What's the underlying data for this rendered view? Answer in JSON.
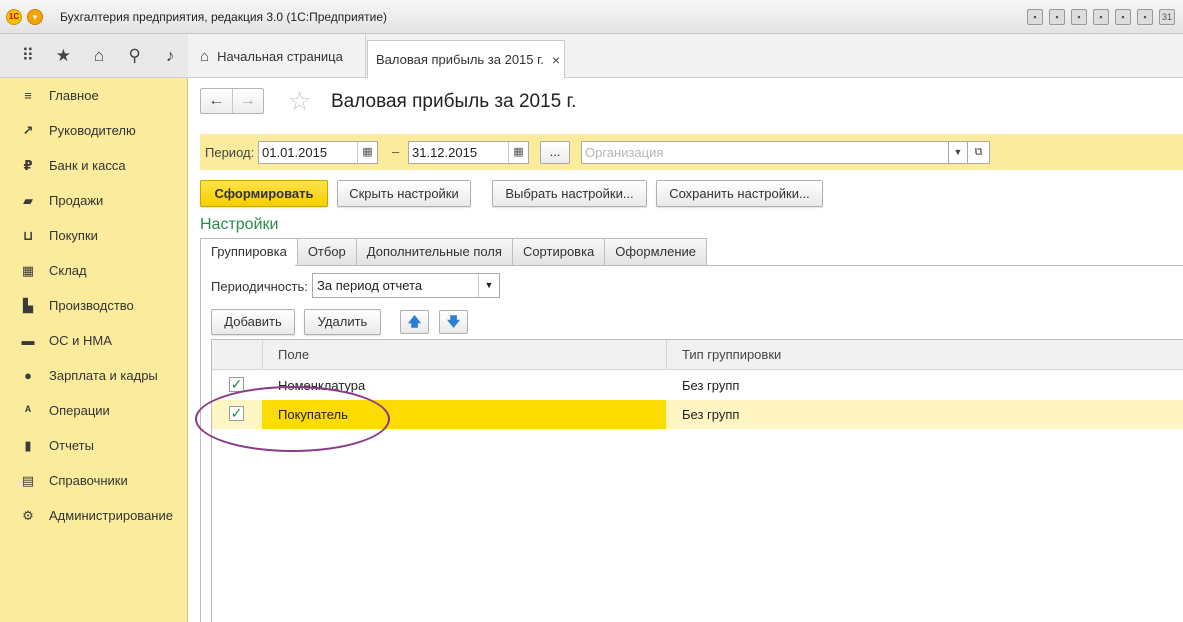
{
  "window": {
    "title": "Бухгалтерия предприятия, редакция 3.0  (1С:Предприятие)",
    "logo_text": "1С"
  },
  "toolbar_icons": [
    "apps-grid-icon",
    "star-icon",
    "history-icon",
    "search-icon",
    "bell-icon"
  ],
  "tabs": {
    "home_label": "Начальная страница",
    "active_label": "Валовая прибыль за 2015 г.",
    "close_glyph": "×"
  },
  "sidebar": {
    "items": [
      {
        "label": "Главное",
        "icon": "≡",
        "icon_name": "menu-icon"
      },
      {
        "label": "Руководителю",
        "icon": "↗",
        "icon_name": "trend-icon"
      },
      {
        "label": "Банк и касса",
        "icon": "₽",
        "icon_name": "ruble-icon"
      },
      {
        "label": "Продажи",
        "icon": "▰",
        "icon_name": "bag-icon"
      },
      {
        "label": "Покупки",
        "icon": "⊔",
        "icon_name": "cart-icon"
      },
      {
        "label": "Склад",
        "icon": "▦",
        "icon_name": "warehouse-icon"
      },
      {
        "label": "Производство",
        "icon": "▙",
        "icon_name": "factory-icon"
      },
      {
        "label": "ОС и НМА",
        "icon": "▬",
        "icon_name": "truck-icon"
      },
      {
        "label": "Зарплата и кадры",
        "icon": "●",
        "icon_name": "person-icon"
      },
      {
        "label": "Операции",
        "icon": "ᴬ",
        "icon_name": "operations-icon"
      },
      {
        "label": "Отчеты",
        "icon": "▮",
        "icon_name": "chart-icon"
      },
      {
        "label": "Справочники",
        "icon": "▤",
        "icon_name": "book-icon"
      },
      {
        "label": "Администрирование",
        "icon": "⚙",
        "icon_name": "gear-icon"
      }
    ]
  },
  "document": {
    "title": "Валовая прибыль за 2015 г."
  },
  "period": {
    "label": "Период:",
    "from": "01.01.2015",
    "to": "31.12.2015",
    "dash": "–",
    "dots": "...",
    "org_placeholder": "Организация"
  },
  "actions": {
    "generate": "Сформировать",
    "hide_settings": "Скрыть настройки",
    "choose_settings": "Выбрать настройки...",
    "save_settings": "Сохранить настройки..."
  },
  "settings": {
    "heading": "Настройки",
    "tabs": [
      "Группировка",
      "Отбор",
      "Дополнительные поля",
      "Сортировка",
      "Оформление"
    ],
    "periodicity_label": "Периодичность:",
    "periodicity_value": "За период отчета",
    "add_label": "Добавить",
    "delete_label": "Удалить",
    "table": {
      "columns": [
        "Поле",
        "Тип группировки"
      ],
      "rows": [
        {
          "checked": true,
          "field": "Номенклатура",
          "type": "Без групп"
        },
        {
          "checked": true,
          "field": "Покупатель",
          "type": "Без групп"
        }
      ]
    }
  },
  "colors": {
    "sidebar_bg": "#fbec9d",
    "primary_button": "#f5cf00",
    "selection": "#fcdc00",
    "heading_green": "#2d8a4e",
    "annotation": "#8a3a8a"
  }
}
